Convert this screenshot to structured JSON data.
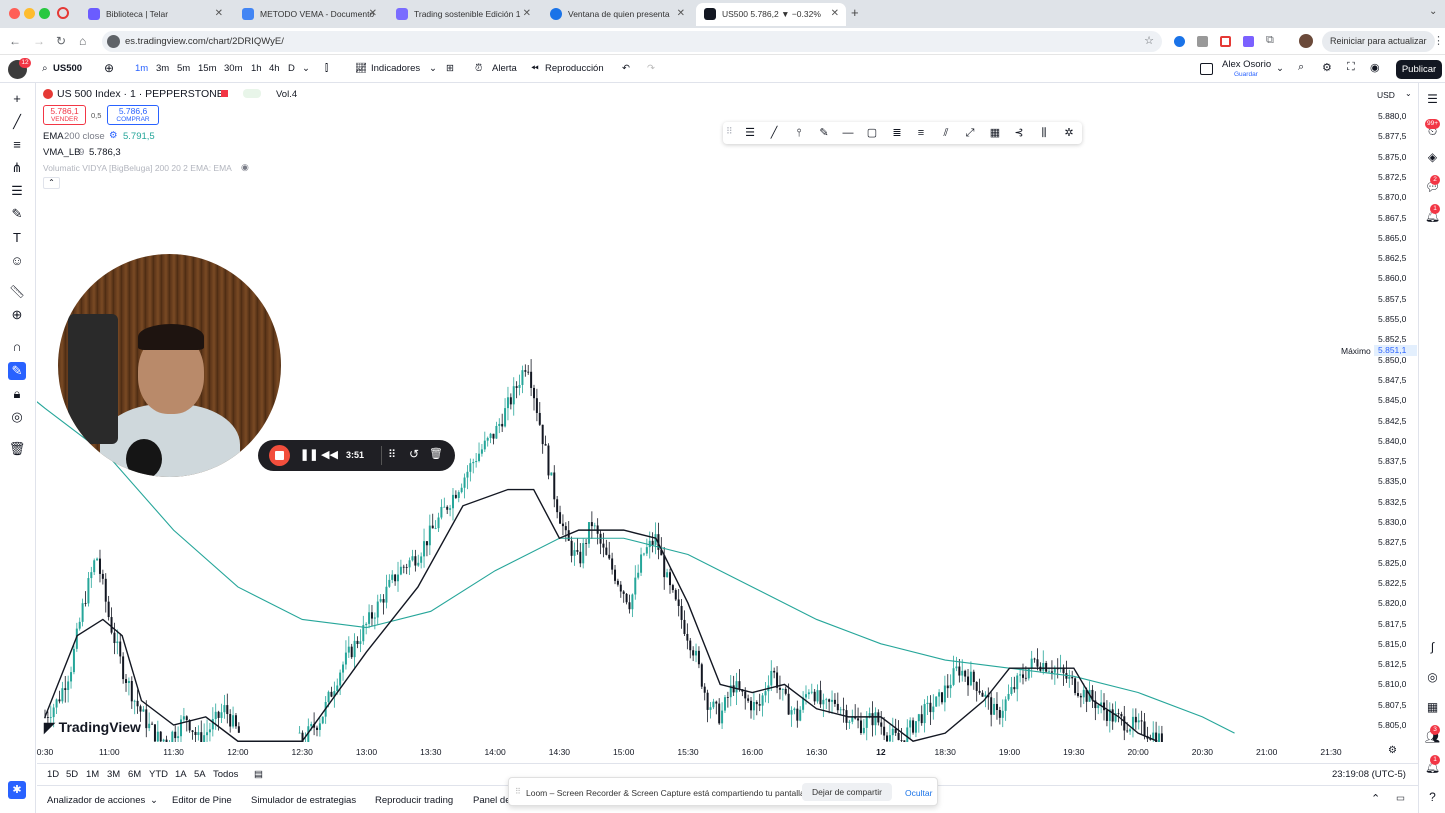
{
  "browser": {
    "tabs": [
      {
        "label": "Biblioteca | Telar",
        "active": false,
        "icon_color": "#6b5cff"
      },
      {
        "label": "METODO VEMA - Documento",
        "active": false,
        "icon_color": "#4285f4"
      },
      {
        "label": "Trading sostenible Edición 1",
        "active": false,
        "icon_color": "#7a6cff"
      },
      {
        "label": "Ventana de quien presenta",
        "active": false,
        "icon_color": "#1a73e8"
      },
      {
        "label": "US500 5.786,2 ▼ −0.32%",
        "active": true,
        "icon_color": "#131722"
      }
    ],
    "url": "es.tradingview.com/chart/2DRIQWyE/",
    "restart_label": "Reiniciar para actualizar"
  },
  "toolbar": {
    "symbol": "US500",
    "intervals": [
      "1m",
      "3m",
      "5m",
      "15m",
      "30m",
      "1h",
      "4h",
      "D"
    ],
    "selected_interval": "1m",
    "indicators_label": "Indicadores",
    "alert_label": "Alerta",
    "replay_label": "Reproducción",
    "user_name": "Alex Osorio",
    "user_sub": "Guardar",
    "publish_label": "Publicar",
    "avatar_badge": "12"
  },
  "legend": {
    "title": "US 500 Index · 1 · PEPPERSTONE",
    "vol": "Vol.4",
    "sell_price": "5.786,1",
    "sell_label": "VENDER",
    "spread": "0,5",
    "buy_price": "5.786,6",
    "buy_label": "COMPRAR",
    "ema_label": "EMA",
    "ema_params": "200 close",
    "ema_value": "5.791,5",
    "vma_label": "VMA_LB",
    "vma_params": "9",
    "vma_value": "5.786,3",
    "vidya_label": "Volumatic VIDYA [BigBeluga] 200 20 2 EMA: EMA"
  },
  "chart_data": {
    "type": "candlestick",
    "price_ticks": [
      "5.880,0",
      "5.877,5",
      "5.875,0",
      "5.872,5",
      "5.870,0",
      "5.867,5",
      "5.865,0",
      "5.862,5",
      "5.860,0",
      "5.857,5",
      "5.855,0",
      "5.852,5",
      "5.850,0",
      "5.847,5",
      "5.845,0",
      "5.842,5",
      "5.840,0",
      "5.837,5",
      "5.835,0",
      "5.832,5",
      "5.830,0",
      "5.827,5",
      "5.825,0",
      "5.822,5",
      "5.820,0",
      "5.817,5",
      "5.815,0",
      "5.812,5",
      "5.810,0",
      "5.807,5",
      "5.805,0"
    ],
    "currency": "USD",
    "max_label": "Máximo",
    "max_value": "5.851,1",
    "time_ticks": [
      "0:30",
      "11:00",
      "11:30",
      "12:00",
      "12:30",
      "13:00",
      "13:30",
      "14:00",
      "14:30",
      "15:00",
      "15:30",
      "16:00",
      "16:30",
      "12",
      "18:30",
      "19:00",
      "19:30",
      "20:00",
      "20:30",
      "21:00",
      "21:30"
    ],
    "ylim": [
      5803,
      5882
    ],
    "colors": {
      "up": "#26a69a",
      "down": "#131722",
      "ema": "#26a69a",
      "vma": "#131722"
    },
    "close_path": [
      [
        0.0,
        5806
      ],
      [
        0.2,
        5808
      ],
      [
        0.4,
        5812
      ],
      [
        0.6,
        5820
      ],
      [
        0.8,
        5826
      ],
      [
        1.0,
        5818
      ],
      [
        1.2,
        5812
      ],
      [
        1.4,
        5808
      ],
      [
        1.6,
        5805
      ],
      [
        1.8,
        5803
      ],
      [
        2.0,
        5804
      ],
      [
        2.2,
        5806
      ],
      [
        2.4,
        5803
      ],
      [
        2.6,
        5805
      ],
      [
        2.8,
        5807
      ],
      [
        3.0,
        5804
      ],
      [
        4.0,
        5803
      ],
      [
        4.3,
        5806
      ],
      [
        4.6,
        5812
      ],
      [
        4.9,
        5816
      ],
      [
        5.2,
        5820
      ],
      [
        5.5,
        5824
      ],
      [
        5.8,
        5826
      ],
      [
        6.1,
        5830
      ],
      [
        6.4,
        5834
      ],
      [
        6.7,
        5838
      ],
      [
        7.0,
        5841
      ],
      [
        7.3,
        5846
      ],
      [
        7.5,
        5850
      ],
      [
        7.7,
        5842
      ],
      [
        7.9,
        5834
      ],
      [
        8.1,
        5828
      ],
      [
        8.3,
        5825
      ],
      [
        8.5,
        5830
      ],
      [
        8.7,
        5826
      ],
      [
        8.9,
        5823
      ],
      [
        9.1,
        5820
      ],
      [
        9.3,
        5826
      ],
      [
        9.5,
        5828
      ],
      [
        9.7,
        5822
      ],
      [
        9.9,
        5818
      ],
      [
        10.1,
        5814
      ],
      [
        10.3,
        5808
      ],
      [
        10.5,
        5806
      ],
      [
        10.7,
        5810
      ],
      [
        10.9,
        5808
      ],
      [
        11.1,
        5807
      ],
      [
        11.3,
        5812
      ],
      [
        11.5,
        5808
      ],
      [
        11.7,
        5806
      ],
      [
        11.9,
        5810
      ],
      [
        12.1,
        5807
      ],
      [
        12.3,
        5808
      ],
      [
        12.5,
        5806
      ],
      [
        12.7,
        5805
      ],
      [
        12.9,
        5806
      ],
      [
        13.1,
        5804
      ],
      [
        13.3,
        5803
      ],
      [
        13.6,
        5806
      ],
      [
        13.9,
        5808
      ],
      [
        14.2,
        5812
      ],
      [
        14.5,
        5810
      ],
      [
        14.8,
        5806
      ],
      [
        15.1,
        5810
      ],
      [
        15.4,
        5813
      ],
      [
        15.7,
        5812
      ],
      [
        16.0,
        5810
      ],
      [
        16.3,
        5808
      ],
      [
        16.6,
        5806
      ],
      [
        16.9,
        5805
      ],
      [
        17.2,
        5804
      ],
      [
        17.4,
        5803
      ]
    ],
    "vma_path": [
      [
        0.0,
        5806
      ],
      [
        0.5,
        5816
      ],
      [
        0.9,
        5818
      ],
      [
        1.2,
        5816
      ],
      [
        1.5,
        5808
      ],
      [
        2.0,
        5805
      ],
      [
        2.5,
        5806
      ],
      [
        3.0,
        5803
      ],
      [
        4.0,
        5803
      ],
      [
        5.0,
        5814
      ],
      [
        5.8,
        5822
      ],
      [
        6.5,
        5832
      ],
      [
        7.2,
        5834
      ],
      [
        7.6,
        5834
      ],
      [
        8.0,
        5828
      ],
      [
        8.3,
        5829
      ],
      [
        9.0,
        5829
      ],
      [
        9.5,
        5828
      ],
      [
        10.0,
        5820
      ],
      [
        10.5,
        5810
      ],
      [
        11.0,
        5809
      ],
      [
        11.5,
        5810
      ],
      [
        12.0,
        5807
      ],
      [
        12.5,
        5806
      ],
      [
        13.0,
        5806
      ],
      [
        13.5,
        5803
      ],
      [
        14.0,
        5804
      ],
      [
        14.6,
        5808
      ],
      [
        15.0,
        5812
      ],
      [
        15.5,
        5812
      ],
      [
        16.0,
        5812
      ],
      [
        16.3,
        5808
      ],
      [
        16.7,
        5806
      ],
      [
        17.0,
        5804
      ],
      [
        17.3,
        5803
      ]
    ],
    "ema_path": [
      [
        -1.1,
        5851
      ],
      [
        0.0,
        5844
      ],
      [
        1.0,
        5838
      ],
      [
        2.0,
        5829
      ],
      [
        3.0,
        5822
      ],
      [
        4.0,
        5818
      ],
      [
        5.0,
        5817
      ],
      [
        6.0,
        5819
      ],
      [
        7.0,
        5824
      ],
      [
        8.0,
        5828
      ],
      [
        9.0,
        5828
      ],
      [
        10.0,
        5826
      ],
      [
        11.0,
        5822
      ],
      [
        12.0,
        5818
      ],
      [
        13.0,
        5815
      ],
      [
        14.0,
        5813
      ],
      [
        15.0,
        5812
      ],
      [
        16.0,
        5811
      ],
      [
        17.0,
        5809
      ],
      [
        18.0,
        5806
      ],
      [
        18.5,
        5804
      ]
    ]
  },
  "drawing_toolbar": {
    "tool_icons": [
      "lines-icon",
      "trendline-icon",
      "fib-icon",
      "brush-icon",
      "horizontal-line-icon",
      "rectangle-icon",
      "parallel-channel-icon",
      "channel-icon",
      "pitchfork-icon",
      "path-icon",
      "table-icon",
      "gann-icon",
      "measure-icon",
      "settings-icon"
    ]
  },
  "loom": {
    "timer": "3:51",
    "banner_text": "Loom – Screen Recorder & Screen Capture está compartiendo tu pantalla.",
    "stop_share_label": "Dejar de compartir",
    "hide_label": "Ocultar"
  },
  "range_bar": {
    "ranges": [
      "1D",
      "5D",
      "1M",
      "3M",
      "6M",
      "YTD",
      "1A",
      "5A",
      "Todos"
    ],
    "clock": "23:19:08 (UTC-5)"
  },
  "bottom_panel": {
    "tabs": [
      "Analizador de acciones",
      "Editor de Pine",
      "Simulador de estrategias",
      "Reproducir trading",
      "Panel de"
    ]
  },
  "branding": {
    "logo_text": "TradingView"
  },
  "right_badges": {
    "notifications": "99+",
    "chat": "2",
    "alerts": "1",
    "people": "3",
    "bell": "1"
  }
}
